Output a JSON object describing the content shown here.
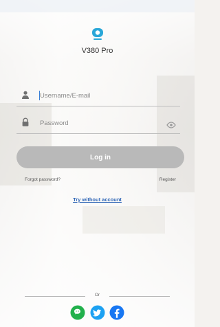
{
  "brand": {
    "app_name": "V380 Pro",
    "accent_color": "#2aa7d8",
    "icon": "camera-logo-icon"
  },
  "form": {
    "username": {
      "placeholder": "Username/E-mail",
      "icon": "user-icon"
    },
    "password": {
      "placeholder": "Password",
      "icon": "lock-icon",
      "toggle_icon": "eye-icon"
    },
    "login_label": "Log in",
    "forgot_label": "Forgot password?",
    "register_label": "Register",
    "try_label": "Try without account"
  },
  "divider": {
    "label": "Or"
  },
  "social": [
    {
      "name": "wechat",
      "icon": "wechat-icon",
      "color": "#22b14c"
    },
    {
      "name": "twitter",
      "icon": "twitter-icon",
      "color": "#1da1f2"
    },
    {
      "name": "facebook",
      "icon": "facebook-icon",
      "color": "#1877f2"
    }
  ]
}
